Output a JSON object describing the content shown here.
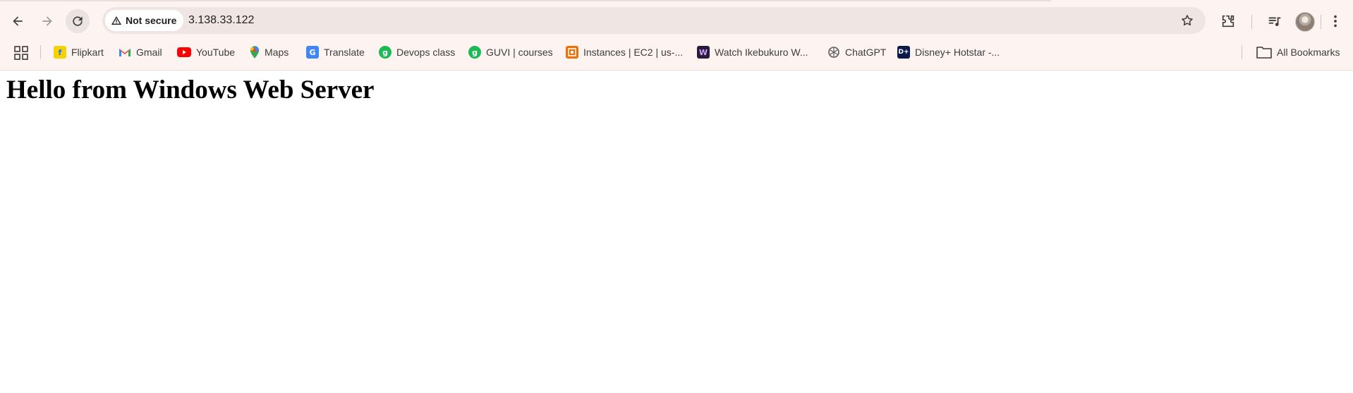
{
  "browser": {
    "url": "3.138.33.122",
    "security_label": "Not secure",
    "icons": {
      "back": "arrow-left-icon",
      "forward": "arrow-right-icon",
      "reload": "reload-icon",
      "bookmark_star": "star-icon",
      "extensions": "puzzle-icon",
      "media": "media-control-icon",
      "menu": "kebab-menu-icon"
    }
  },
  "bookmarks": {
    "items": [
      {
        "label": "Flipkart",
        "icon": "flipkart-icon",
        "color": "#2874f0"
      },
      {
        "label": "Gmail",
        "icon": "gmail-icon",
        "color": "#ea4335"
      },
      {
        "label": "YouTube",
        "icon": "youtube-icon",
        "color": "#ff0000"
      },
      {
        "label": "Maps",
        "icon": "maps-pin-icon",
        "color": "#34a853"
      },
      {
        "label": "Translate",
        "icon": "translate-icon",
        "color": "#4285f4"
      },
      {
        "label": "Devops class",
        "icon": "guvi-icon",
        "color": "#1db954"
      },
      {
        "label": "GUVI | courses",
        "icon": "guvi-icon",
        "color": "#1db954"
      },
      {
        "label": "Instances | EC2 | us-...",
        "icon": "aws-ec2-icon",
        "color": "#e8710a"
      },
      {
        "label": "Watch Ikebukuro W...",
        "icon": "w-logo-icon",
        "color": "#2a1a3a"
      },
      {
        "label": "ChatGPT",
        "icon": "chatgpt-icon",
        "color": "#5a5a5a"
      },
      {
        "label": "Disney+ Hotstar -...",
        "icon": "hotstar-icon",
        "color": "#0c1a4a"
      }
    ],
    "all_bookmarks_label": "All Bookmarks"
  },
  "page": {
    "heading": "Hello from Windows Web Server"
  }
}
